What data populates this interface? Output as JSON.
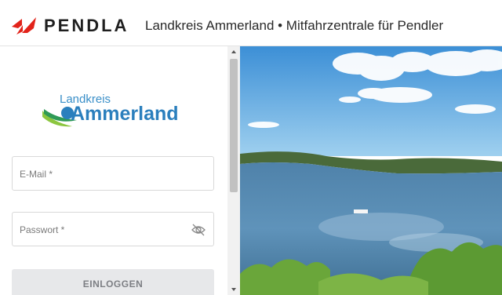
{
  "header": {
    "brand_name": "PENDLA",
    "title": "Landkreis Ammerland • Mitfahrzentrale für Pendler",
    "brand_icon": "pendla-logo-icon"
  },
  "logo": {
    "small_text": "Landkreis",
    "big_text": "Ammerland"
  },
  "form": {
    "email_label": "E-Mail *",
    "password_label": "Passwort *",
    "password_toggle_icon": "eye-off-icon",
    "login_label": "EINLOGGEN"
  },
  "colors": {
    "brand_red": "#e2231a",
    "logo_blue": "#2b7fbd",
    "logo_green": "#8cc63f",
    "button_bg": "#e7e8ea"
  }
}
